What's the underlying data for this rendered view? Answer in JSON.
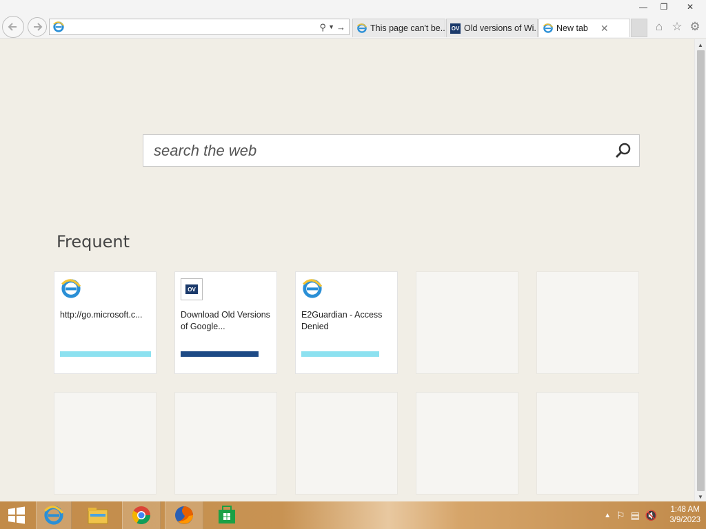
{
  "window": {
    "minimize_label": "—",
    "restore_label": "❐",
    "close_label": "✕"
  },
  "addressbar": {
    "value": "",
    "search_icon": "search-icon",
    "dropdown_icon": "chevron-down-icon",
    "go_icon": "arrow-right-icon"
  },
  "tabs": [
    {
      "label": "This page can't be...",
      "icon": "ie-icon",
      "active": false,
      "width": 135
    },
    {
      "label": "Old versions of Wi...",
      "icon": "ov-icon",
      "active": false,
      "width": 133
    },
    {
      "label": "New tab",
      "icon": "ie-icon",
      "active": true,
      "width": 133
    }
  ],
  "toolbar": {
    "home_icon": "home-icon",
    "favorites_icon": "star-icon",
    "settings_icon": "gear-icon"
  },
  "search": {
    "placeholder": "search the web"
  },
  "frequent": {
    "heading": "Frequent",
    "tiles": [
      {
        "label": "http://go.microsoft.c...",
        "icon": "ie-icon",
        "bar_color": "#8ce1f0",
        "bar_fraction": 0.99
      },
      {
        "label": "Download Old Versions of Google...",
        "icon": "ov-icon",
        "bar_color": "#1d4a85",
        "bar_fraction": 0.85
      },
      {
        "label": "E2Guardian - Access Denied",
        "icon": "ie-icon",
        "bar_color": "#8ce1f0",
        "bar_fraction": 0.85
      }
    ],
    "ov_badge": "OV"
  },
  "taskbar": {
    "apps": [
      "start-button",
      "internet-explorer",
      "file-explorer",
      "chrome",
      "firefox",
      "windows-store"
    ],
    "clock_time": "1:48 AM",
    "clock_date": "3/9/2023"
  }
}
